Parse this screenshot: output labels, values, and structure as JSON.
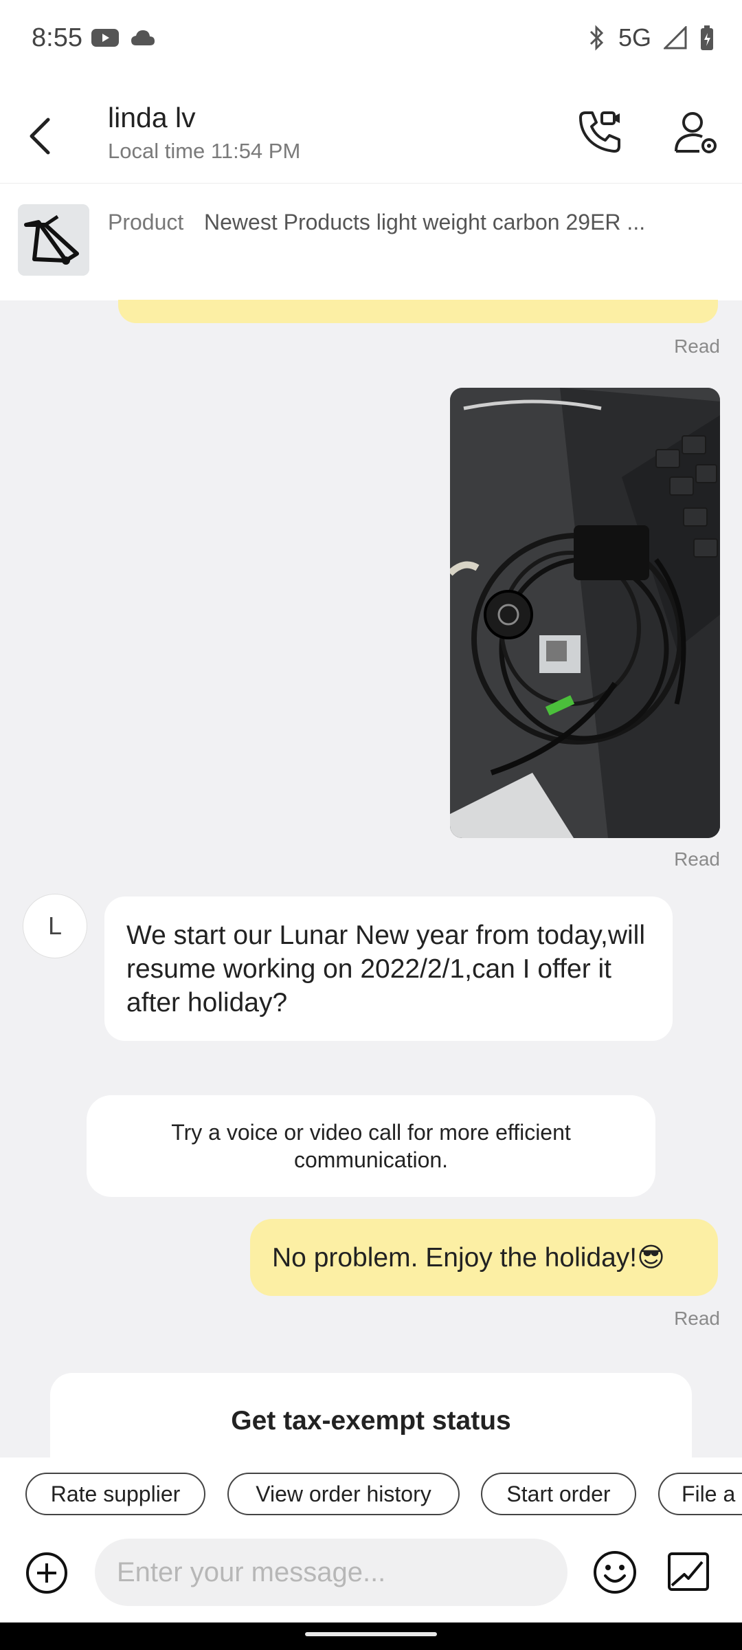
{
  "status_bar": {
    "time": "8:55",
    "network": "5G"
  },
  "header": {
    "name": "linda lv",
    "local_time": "Local time 11:54 PM"
  },
  "product": {
    "label": "Product",
    "title": "Newest Products light weight carbon 29ER ..."
  },
  "chat": {
    "read_label": "Read",
    "avatar_initial": "L",
    "incoming_message": "We start our Lunar New year from today,will resume working on 2022/2/1,can I offer it after holiday?",
    "system_note": "Try a voice or video call for more efficient communication.",
    "outgoing_message": "No problem. Enjoy the holiday!😎",
    "tax_card_title": "Get tax-exempt status"
  },
  "quick_actions": [
    {
      "label": "Rate supplier"
    },
    {
      "label": "View order history"
    },
    {
      "label": "Start order"
    },
    {
      "label": "File a c"
    }
  ],
  "input": {
    "placeholder": "Enter your message..."
  },
  "colors": {
    "outgoing_bubble": "#fcefa4",
    "background": "#f1f1f3"
  }
}
